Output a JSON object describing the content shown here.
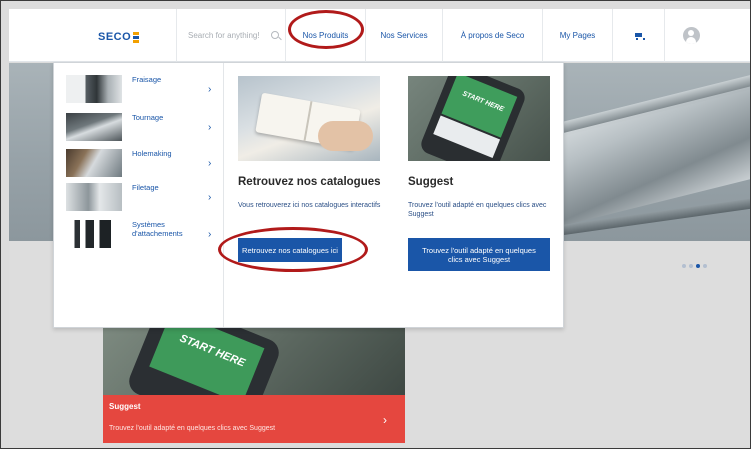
{
  "header": {
    "logo_text": "SECO",
    "search_placeholder": "Search for anything!",
    "nav": {
      "produits": "Nos Produits",
      "services": "Nos Services",
      "apropos": "À propos de Seco",
      "mypages": "My Pages"
    }
  },
  "menu": {
    "categories": [
      {
        "label": "Fraisage"
      },
      {
        "label": "Tournage"
      },
      {
        "label": "Holemaking"
      },
      {
        "label": "Filetage"
      },
      {
        "label": "Systèmes\nd'attachements"
      }
    ],
    "catalog": {
      "title": "Retrouvez nos catalogues",
      "description": "Vous retrouverez ici nos catalogues interactifs",
      "button": "Retrouvez nos catalogues ici"
    },
    "suggest": {
      "title": "Suggest",
      "description": "Trouvez l'outil adapté en quelques clics avec Suggest",
      "button": "Trouvez l'outil adapté en quelques clics avec Suggest"
    },
    "phone_screen_text": "START HERE"
  },
  "background_card": {
    "title": "Suggest",
    "subtitle": "Trouvez l'outil adapté en quelques clics avec Suggest",
    "phone_screen_text": "START HERE"
  },
  "carousel": {
    "dot_count": 4,
    "active_index": 2
  },
  "colors": {
    "brand_blue": "#1a56a8",
    "annotation_red": "#b11a1a",
    "card_red": "#e5473f"
  }
}
